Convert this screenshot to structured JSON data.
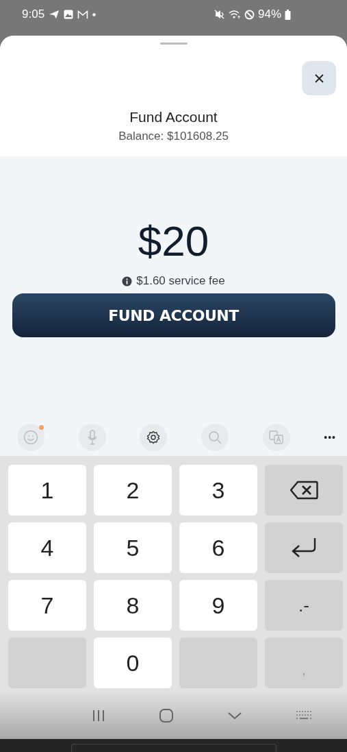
{
  "status_bar": {
    "time": "9:05",
    "battery": "94%"
  },
  "sheet": {
    "title": "Fund Account",
    "balance": "Balance: $101608.25",
    "amount": "$20",
    "fee": "$1.60 service fee",
    "button": "FUND ACCOUNT"
  },
  "keyboard_toolbar": {
    "more": "•••",
    "emoji_badge": true
  },
  "keys": [
    {
      "kind": "digit",
      "label": "1"
    },
    {
      "kind": "digit",
      "label": "2"
    },
    {
      "kind": "digit",
      "label": "3"
    },
    {
      "kind": "backspace"
    },
    {
      "kind": "digit",
      "label": "4"
    },
    {
      "kind": "digit",
      "label": "5"
    },
    {
      "kind": "digit",
      "label": "6"
    },
    {
      "kind": "enter"
    },
    {
      "kind": "digit",
      "label": "7"
    },
    {
      "kind": "digit",
      "label": "8"
    },
    {
      "kind": "digit",
      "label": "9"
    },
    {
      "kind": "symbol",
      "label": ".-"
    },
    {
      "kind": "blank"
    },
    {
      "kind": "digit",
      "label": "0"
    },
    {
      "kind": "blank"
    },
    {
      "kind": "symbol",
      "label": ","
    }
  ]
}
